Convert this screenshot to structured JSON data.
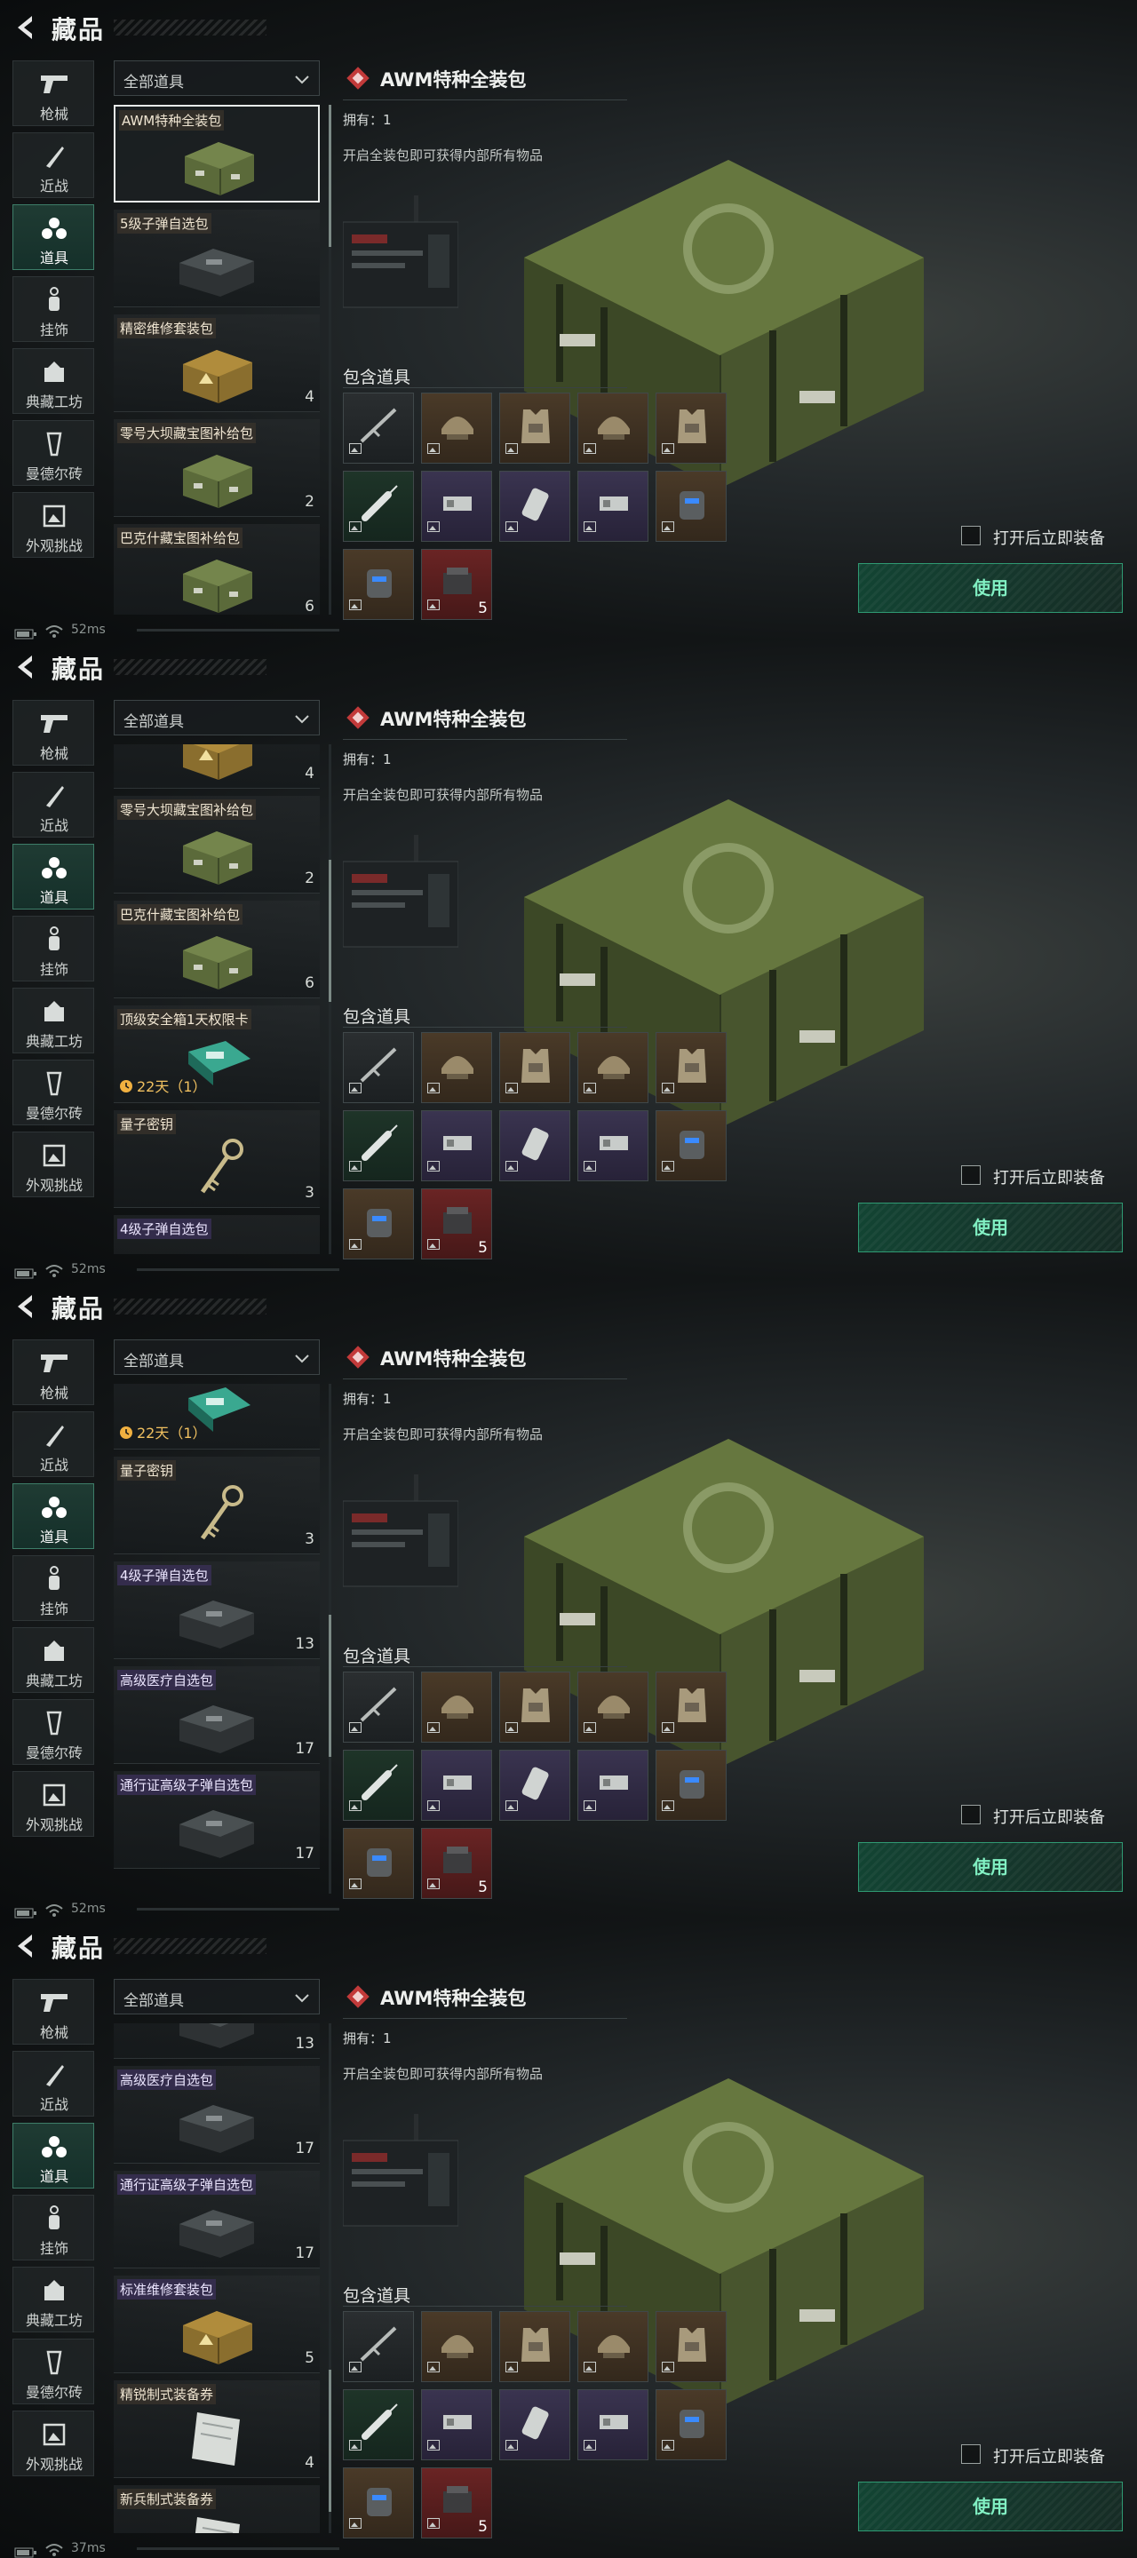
{
  "page": {
    "title": "藏品",
    "back_icon": "back-arrow-icon"
  },
  "sidebar": {
    "items": [
      {
        "label": "枪械",
        "icon": "pistol-icon"
      },
      {
        "label": "近战",
        "icon": "knife-icon"
      },
      {
        "label": "道具",
        "icon": "items-icon"
      },
      {
        "label": "挂饰",
        "icon": "charm-icon"
      },
      {
        "label": "典藏工坊",
        "icon": "workshop-icon"
      },
      {
        "label": "曼德尔砖",
        "icon": "brick-icon"
      },
      {
        "label": "外观挑战",
        "icon": "challenge-icon"
      }
    ],
    "active_index": 2
  },
  "filter": {
    "value": "全部道具"
  },
  "detail": {
    "name": "AWM特种全装包",
    "owned": "拥有：1",
    "description": "开启全装包即可获得内部所有物品",
    "contains_title": "包含道具",
    "slots": [
      {
        "quality": "dark",
        "icon": "rifle-icon",
        "count": ""
      },
      {
        "quality": "orange",
        "icon": "helmet-icon",
        "count": ""
      },
      {
        "quality": "orange",
        "icon": "vest-icon",
        "count": ""
      },
      {
        "quality": "orange",
        "icon": "helmet-icon",
        "count": ""
      },
      {
        "quality": "orange",
        "icon": "vest-icon",
        "count": ""
      },
      {
        "quality": "green",
        "icon": "syringe-icon",
        "count": ""
      },
      {
        "quality": "purple",
        "icon": "battery-icon",
        "count": ""
      },
      {
        "quality": "purple",
        "icon": "grenade-icon",
        "count": ""
      },
      {
        "quality": "purple",
        "icon": "battery-icon",
        "count": ""
      },
      {
        "quality": "orange",
        "icon": "backpack-icon",
        "count": ""
      },
      {
        "quality": "orange",
        "icon": "backpack-icon",
        "count": ""
      },
      {
        "quality": "red",
        "icon": "ammo-box-icon",
        "count": "5"
      }
    ],
    "equip_label": "打开后立即装备",
    "use_label": "使用"
  },
  "status": {
    "ping": [
      "52ms",
      "52ms",
      "52ms",
      "37ms"
    ]
  },
  "frames": [
    {
      "cards": [
        {
          "name": "AWM特种全装包",
          "qty": "",
          "timer": "",
          "selected": true,
          "purple": false,
          "art": "crate-green"
        },
        {
          "name": "5级子弹自选包",
          "qty": "",
          "timer": "",
          "selected": false,
          "purple": false,
          "art": "case-dark"
        },
        {
          "name": "精密维修套装包",
          "qty": "4",
          "timer": "",
          "selected": false,
          "purple": false,
          "art": "crate-gold"
        },
        {
          "name": "零号大坝藏宝图补给包",
          "qty": "2",
          "timer": "",
          "selected": false,
          "purple": false,
          "art": "crate-green"
        },
        {
          "name": "巴克什藏宝图补给包",
          "qty": "6",
          "timer": "",
          "selected": false,
          "purple": false,
          "art": "crate-green"
        }
      ]
    },
    {
      "cards": [
        {
          "name": "",
          "qty": "4",
          "timer": "",
          "selected": false,
          "purple": false,
          "art": "crate-gold"
        },
        {
          "name": "零号大坝藏宝图补给包",
          "qty": "2",
          "timer": "",
          "selected": false,
          "purple": false,
          "art": "crate-green"
        },
        {
          "name": "巴克什藏宝图补给包",
          "qty": "6",
          "timer": "",
          "selected": false,
          "purple": false,
          "art": "crate-green"
        },
        {
          "name": "顶级安全箱1天权限卡",
          "qty": "",
          "timer": "22天（1）",
          "selected": false,
          "purple": false,
          "art": "keycard"
        },
        {
          "name": "量子密钥",
          "qty": "3",
          "timer": "",
          "selected": false,
          "purple": false,
          "art": "key"
        },
        {
          "name": "4级子弹自选包",
          "qty": "",
          "timer": "",
          "selected": false,
          "purple": true,
          "art": "case-dark"
        }
      ]
    },
    {
      "cards": [
        {
          "name": "顶级安全箱1天权限卡",
          "qty": "",
          "timer": "22天（1）",
          "selected": false,
          "purple": false,
          "art": "keycard"
        },
        {
          "name": "量子密钥",
          "qty": "3",
          "timer": "",
          "selected": false,
          "purple": false,
          "art": "key"
        },
        {
          "name": "4级子弹自选包",
          "qty": "13",
          "timer": "",
          "selected": false,
          "purple": true,
          "art": "case-dark"
        },
        {
          "name": "高级医疗自选包",
          "qty": "17",
          "timer": "",
          "selected": false,
          "purple": true,
          "art": "case-dark"
        },
        {
          "name": "通行证高级子弹自选包",
          "qty": "17",
          "timer": "",
          "selected": false,
          "purple": true,
          "art": "case-dark"
        }
      ]
    },
    {
      "cards": [
        {
          "name": "",
          "qty": "13",
          "timer": "",
          "selected": false,
          "purple": false,
          "art": "case-dark"
        },
        {
          "name": "高级医疗自选包",
          "qty": "17",
          "timer": "",
          "selected": false,
          "purple": true,
          "art": "case-dark"
        },
        {
          "name": "通行证高级子弹自选包",
          "qty": "17",
          "timer": "",
          "selected": false,
          "purple": true,
          "art": "case-dark"
        },
        {
          "name": "标准维修套装包",
          "qty": "5",
          "timer": "",
          "selected": false,
          "purple": true,
          "art": "crate-gold"
        },
        {
          "name": "精锐制式装备券",
          "qty": "4",
          "timer": "",
          "selected": false,
          "purple": false,
          "art": "ticket"
        },
        {
          "name": "新兵制式装备券",
          "qty": "",
          "timer": "",
          "selected": false,
          "purple": false,
          "art": "ticket"
        }
      ]
    }
  ]
}
